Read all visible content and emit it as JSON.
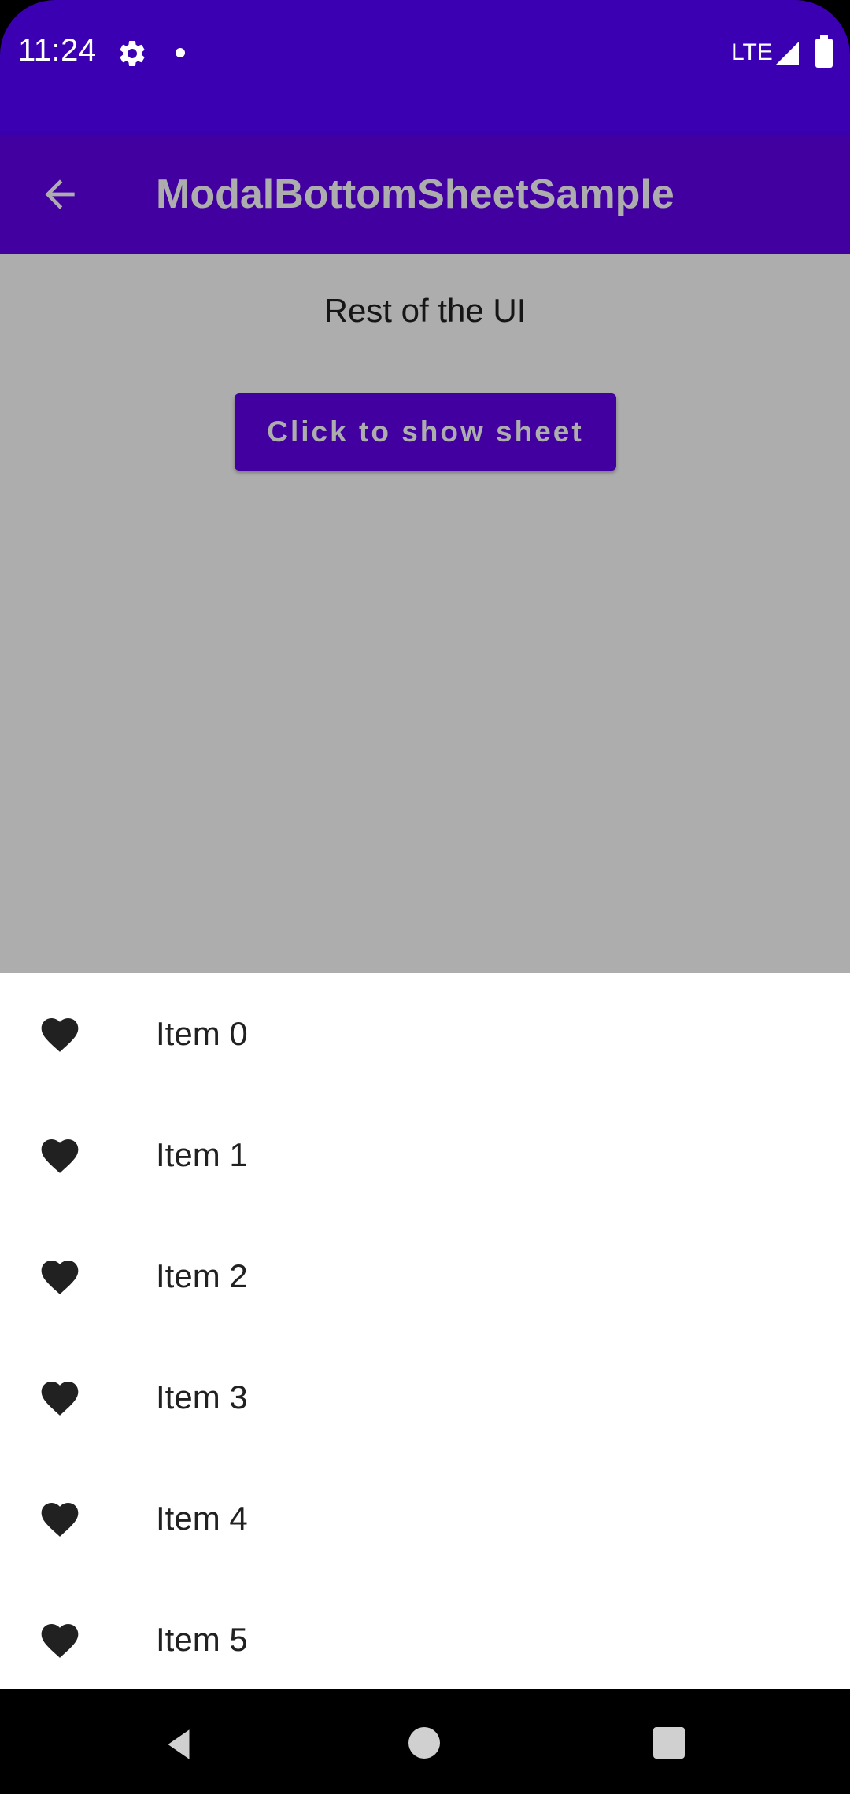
{
  "status_bar": {
    "time": "11:24",
    "network": "LTE",
    "icons": [
      "settings-icon",
      "notification-dot-icon",
      "signal-icon",
      "battery-icon"
    ]
  },
  "app_bar": {
    "title": "ModalBottomSheetSample",
    "back_icon": "arrow-back-icon"
  },
  "content": {
    "text": "Rest of the UI",
    "button_label": "Click to show sheet"
  },
  "sheet": {
    "items": [
      {
        "icon": "heart-icon",
        "label": "Item 0"
      },
      {
        "icon": "heart-icon",
        "label": "Item 1"
      },
      {
        "icon": "heart-icon",
        "label": "Item 2"
      },
      {
        "icon": "heart-icon",
        "label": "Item 3"
      },
      {
        "icon": "heart-icon",
        "label": "Item 4"
      },
      {
        "icon": "heart-icon",
        "label": "Item 5"
      }
    ]
  },
  "nav_bar": {
    "buttons": [
      "back-icon",
      "home-icon",
      "recents-icon"
    ]
  },
  "colors": {
    "status_bar": "#3a00b1",
    "primary": "#6200ee",
    "scrim": "rgba(0,0,0,0.32)",
    "icon": "#212121"
  }
}
